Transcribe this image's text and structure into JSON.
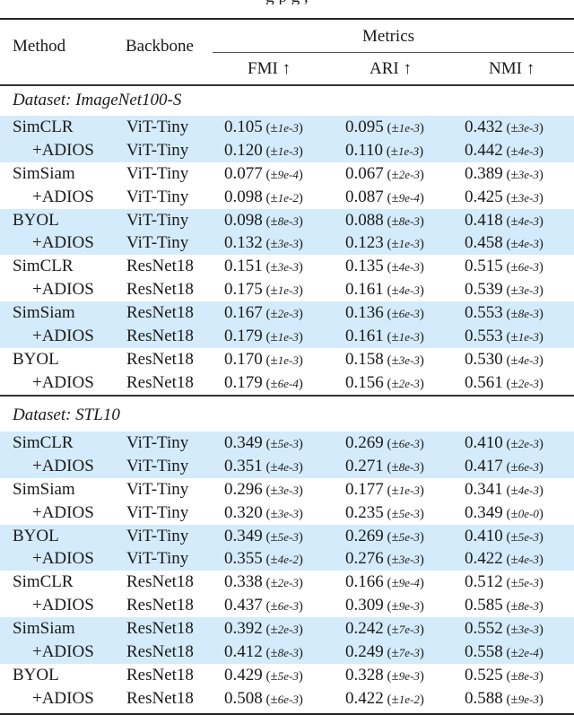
{
  "caption_fragment": "g p                        g              ,",
  "header": {
    "method": "Method",
    "backbone": "Backbone",
    "metrics_group": "Metrics",
    "columns": [
      "FMI ↑",
      "ARI ↑",
      "NMI ↑"
    ]
  },
  "sections": [
    {
      "label": "Dataset: ImageNet100-S",
      "rows": [
        {
          "method": "SimCLR",
          "is_adios": false,
          "highlight": true,
          "backbone": "ViT-Tiny",
          "fmi": "0.105",
          "fmi_std": "1e-3",
          "ari": "0.095",
          "ari_std": "1e-3",
          "nmi": "0.432",
          "nmi_std": "3e-3"
        },
        {
          "method": "+ADIOS",
          "is_adios": true,
          "highlight": true,
          "backbone": "ViT-Tiny",
          "fmi": "0.120",
          "fmi_std": "1e-3",
          "ari": "0.110",
          "ari_std": "1e-3",
          "nmi": "0.442",
          "nmi_std": "4e-3"
        },
        {
          "method": "SimSiam",
          "is_adios": false,
          "highlight": false,
          "backbone": "ViT-Tiny",
          "fmi": "0.077",
          "fmi_std": "9e-4",
          "ari": "0.067",
          "ari_std": "2e-3",
          "nmi": "0.389",
          "nmi_std": "3e-3"
        },
        {
          "method": "+ADIOS",
          "is_adios": true,
          "highlight": false,
          "backbone": "ViT-Tiny",
          "fmi": "0.098",
          "fmi_std": "1e-2",
          "ari": "0.087",
          "ari_std": "9e-4",
          "nmi": "0.425",
          "nmi_std": "3e-3"
        },
        {
          "method": "BYOL",
          "is_adios": false,
          "highlight": true,
          "backbone": "ViT-Tiny",
          "fmi": "0.098",
          "fmi_std": "8e-3",
          "ari": "0.088",
          "ari_std": "8e-3",
          "nmi": "0.418",
          "nmi_std": "4e-3"
        },
        {
          "method": "+ADIOS",
          "is_adios": true,
          "highlight": true,
          "backbone": "ViT-Tiny",
          "fmi": "0.132",
          "fmi_std": "3e-3",
          "ari": "0.123",
          "ari_std": "1e-3",
          "nmi": "0.458",
          "nmi_std": "4e-3"
        },
        {
          "method": "SimCLR",
          "is_adios": false,
          "highlight": false,
          "backbone": "ResNet18",
          "fmi": "0.151",
          "fmi_std": "3e-3",
          "ari": "0.135",
          "ari_std": "4e-3",
          "nmi": "0.515",
          "nmi_std": "6e-3"
        },
        {
          "method": "+ADIOS",
          "is_adios": true,
          "highlight": false,
          "backbone": "ResNet18",
          "fmi": "0.175",
          "fmi_std": "1e-3",
          "ari": "0.161",
          "ari_std": "4e-3",
          "nmi": "0.539",
          "nmi_std": "3e-3"
        },
        {
          "method": "SimSiam",
          "is_adios": false,
          "highlight": true,
          "backbone": "ResNet18",
          "fmi": "0.167",
          "fmi_std": "2e-3",
          "ari": "0.136",
          "ari_std": "6e-3",
          "nmi": "0.553",
          "nmi_std": "8e-3"
        },
        {
          "method": "+ADIOS",
          "is_adios": true,
          "highlight": true,
          "backbone": "ResNet18",
          "fmi": "0.179",
          "fmi_std": "1e-3",
          "ari": "0.161",
          "ari_std": "1e-3",
          "nmi": "0.553",
          "nmi_std": "1e-3"
        },
        {
          "method": "BYOL",
          "is_adios": false,
          "highlight": false,
          "backbone": "ResNet18",
          "fmi": "0.170",
          "fmi_std": "1e-3",
          "ari": "0.158",
          "ari_std": "3e-3",
          "nmi": "0.530",
          "nmi_std": "4e-3"
        },
        {
          "method": "+ADIOS",
          "is_adios": true,
          "highlight": false,
          "backbone": "ResNet18",
          "fmi": "0.179",
          "fmi_std": "6e-4",
          "ari": "0.156",
          "ari_std": "2e-3",
          "nmi": "0.561",
          "nmi_std": "2e-3"
        }
      ]
    },
    {
      "label": "Dataset: STL10",
      "rows": [
        {
          "method": "SimCLR",
          "is_adios": false,
          "highlight": true,
          "backbone": "ViT-Tiny",
          "fmi": "0.349",
          "fmi_std": "5e-3",
          "ari": "0.269",
          "ari_std": "6e-3",
          "nmi": "0.410",
          "nmi_std": "2e-3"
        },
        {
          "method": "+ADIOS",
          "is_adios": true,
          "highlight": true,
          "backbone": "ViT-Tiny",
          "fmi": "0.351",
          "fmi_std": "4e-3",
          "ari": "0.271",
          "ari_std": "8e-3",
          "nmi": "0.417",
          "nmi_std": "6e-3"
        },
        {
          "method": "SimSiam",
          "is_adios": false,
          "highlight": false,
          "backbone": "ViT-Tiny",
          "fmi": "0.296",
          "fmi_std": "3e-3",
          "ari": "0.177",
          "ari_std": "1e-3",
          "nmi": "0.341",
          "nmi_std": "4e-3"
        },
        {
          "method": "+ADIOS",
          "is_adios": true,
          "highlight": false,
          "backbone": "ViT-Tiny",
          "fmi": "0.320",
          "fmi_std": "3e-3",
          "ari": "0.235",
          "ari_std": "5e-3",
          "nmi": "0.349",
          "nmi_std": "0e-0"
        },
        {
          "method": "BYOL",
          "is_adios": false,
          "highlight": true,
          "backbone": "ViT-Tiny",
          "fmi": "0.349",
          "fmi_std": "5e-3",
          "ari": "0.269",
          "ari_std": "5e-3",
          "nmi": "0.410",
          "nmi_std": "5e-3"
        },
        {
          "method": "+ADIOS",
          "is_adios": true,
          "highlight": true,
          "backbone": "ViT-Tiny",
          "fmi": "0.355",
          "fmi_std": "4e-2",
          "ari": "0.276",
          "ari_std": "3e-3",
          "nmi": "0.422",
          "nmi_std": "4e-3"
        },
        {
          "method": "SimCLR",
          "is_adios": false,
          "highlight": false,
          "backbone": "ResNet18",
          "fmi": "0.338",
          "fmi_std": "2e-3",
          "ari": "0.166",
          "ari_std": "9e-4",
          "nmi": "0.512",
          "nmi_std": "5e-3"
        },
        {
          "method": "+ADIOS",
          "is_adios": true,
          "highlight": false,
          "backbone": "ResNet18",
          "fmi": "0.437",
          "fmi_std": "6e-3",
          "ari": "0.309",
          "ari_std": "9e-3",
          "nmi": "0.585",
          "nmi_std": "8e-3"
        },
        {
          "method": "SimSiam",
          "is_adios": false,
          "highlight": true,
          "backbone": "ResNet18",
          "fmi": "0.392",
          "fmi_std": "2e-3",
          "ari": "0.242",
          "ari_std": "7e-3",
          "nmi": "0.552",
          "nmi_std": "3e-3"
        },
        {
          "method": "+ADIOS",
          "is_adios": true,
          "highlight": true,
          "backbone": "ResNet18",
          "fmi": "0.412",
          "fmi_std": "8e-3",
          "ari": "0.249",
          "ari_std": "7e-3",
          "nmi": "0.558",
          "nmi_std": "2e-4"
        },
        {
          "method": "BYOL",
          "is_adios": false,
          "highlight": false,
          "backbone": "ResNet18",
          "fmi": "0.429",
          "fmi_std": "5e-3",
          "ari": "0.328",
          "ari_std": "9e-3",
          "nmi": "0.525",
          "nmi_std": "8e-3"
        },
        {
          "method": "+ADIOS",
          "is_adios": true,
          "highlight": false,
          "backbone": "ResNet18",
          "fmi": "0.508",
          "fmi_std": "6e-3",
          "ari": "0.422",
          "ari_std": "1e-2",
          "nmi": "0.588",
          "nmi_std": "9e-3"
        }
      ]
    }
  ],
  "colors": {
    "highlight_row": "#d4ebfb",
    "rule": "#222222"
  }
}
